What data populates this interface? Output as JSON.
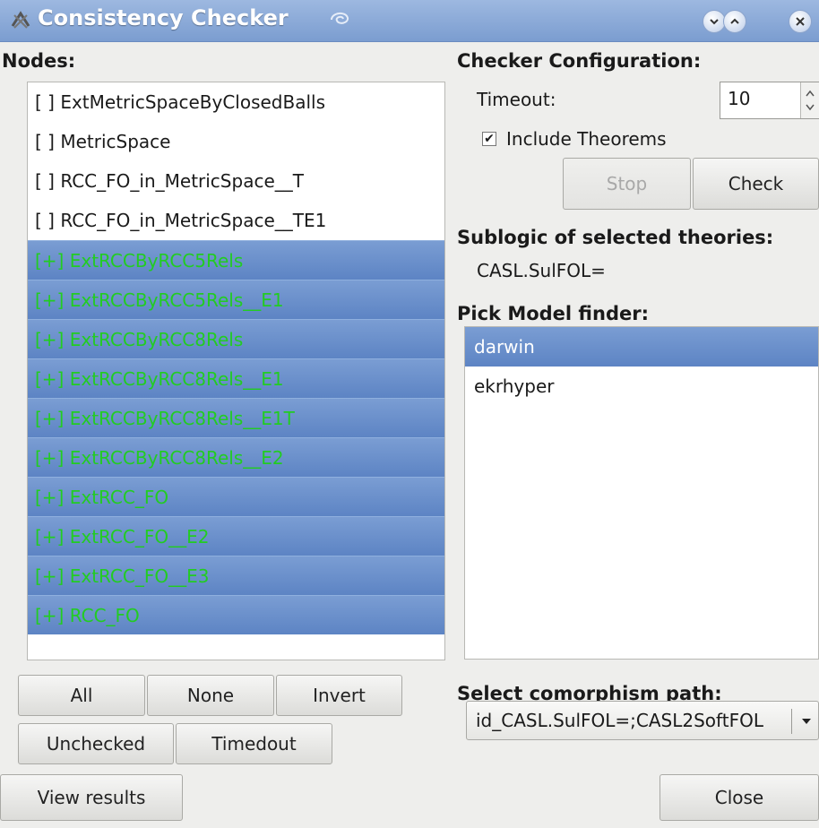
{
  "window": {
    "title": "Consistency Checker",
    "icons": [
      "app-icon",
      "swirl-icon",
      "minimize-icon",
      "maximize-icon",
      "close-icon"
    ]
  },
  "nodes": {
    "heading": "Nodes:",
    "items": [
      {
        "label": "[ ] ExtMetricSpaceByClosedBalls",
        "selected": false
      },
      {
        "label": "[ ] MetricSpace",
        "selected": false
      },
      {
        "label": "[ ] RCC_FO_in_MetricSpace__T",
        "selected": false
      },
      {
        "label": "[ ] RCC_FO_in_MetricSpace__TE1",
        "selected": false
      },
      {
        "label": "[+] ExtRCCByRCC5Rels",
        "selected": true
      },
      {
        "label": "[+] ExtRCCByRCC5Rels__E1",
        "selected": true
      },
      {
        "label": "[+] ExtRCCByRCC8Rels",
        "selected": true
      },
      {
        "label": "[+] ExtRCCByRCC8Rels__E1",
        "selected": true
      },
      {
        "label": "[+] ExtRCCByRCC8Rels__E1T",
        "selected": true
      },
      {
        "label": "[+] ExtRCCByRCC8Rels__E2",
        "selected": true
      },
      {
        "label": "[+] ExtRCC_FO",
        "selected": true
      },
      {
        "label": "[+] ExtRCC_FO__E2",
        "selected": true
      },
      {
        "label": "[+] ExtRCC_FO__E3",
        "selected": true
      },
      {
        "label": "[+] RCC_FO",
        "selected": true
      }
    ]
  },
  "selection_buttons": {
    "all": "All",
    "none": "None",
    "invert": "Invert",
    "unchecked": "Unchecked",
    "timedout": "Timedout"
  },
  "checker": {
    "heading": "Checker Configuration:",
    "timeout_label": "Timeout:",
    "timeout_value": "10",
    "include_theorems_label": "Include Theorems",
    "include_theorems_checked": "✔",
    "stop_label": "Stop",
    "check_label": "Check"
  },
  "sublogic": {
    "heading": "Sublogic of selected theories:",
    "value": "CASL.SulFOL="
  },
  "model_finder": {
    "heading": "Pick Model finder:",
    "items": [
      {
        "label": "darwin",
        "selected": true
      },
      {
        "label": "ekrhyper",
        "selected": false
      }
    ]
  },
  "comorphism": {
    "heading": "Select comorphism path:",
    "value": "id_CASL.SulFOL=;CASL2SoftFOL"
  },
  "bottom": {
    "view_results": "View results",
    "close": "Close"
  },
  "colors": {
    "selection": "#6b8fcc",
    "green_text": "#22cc22",
    "titlebar": "#8aaad8"
  }
}
